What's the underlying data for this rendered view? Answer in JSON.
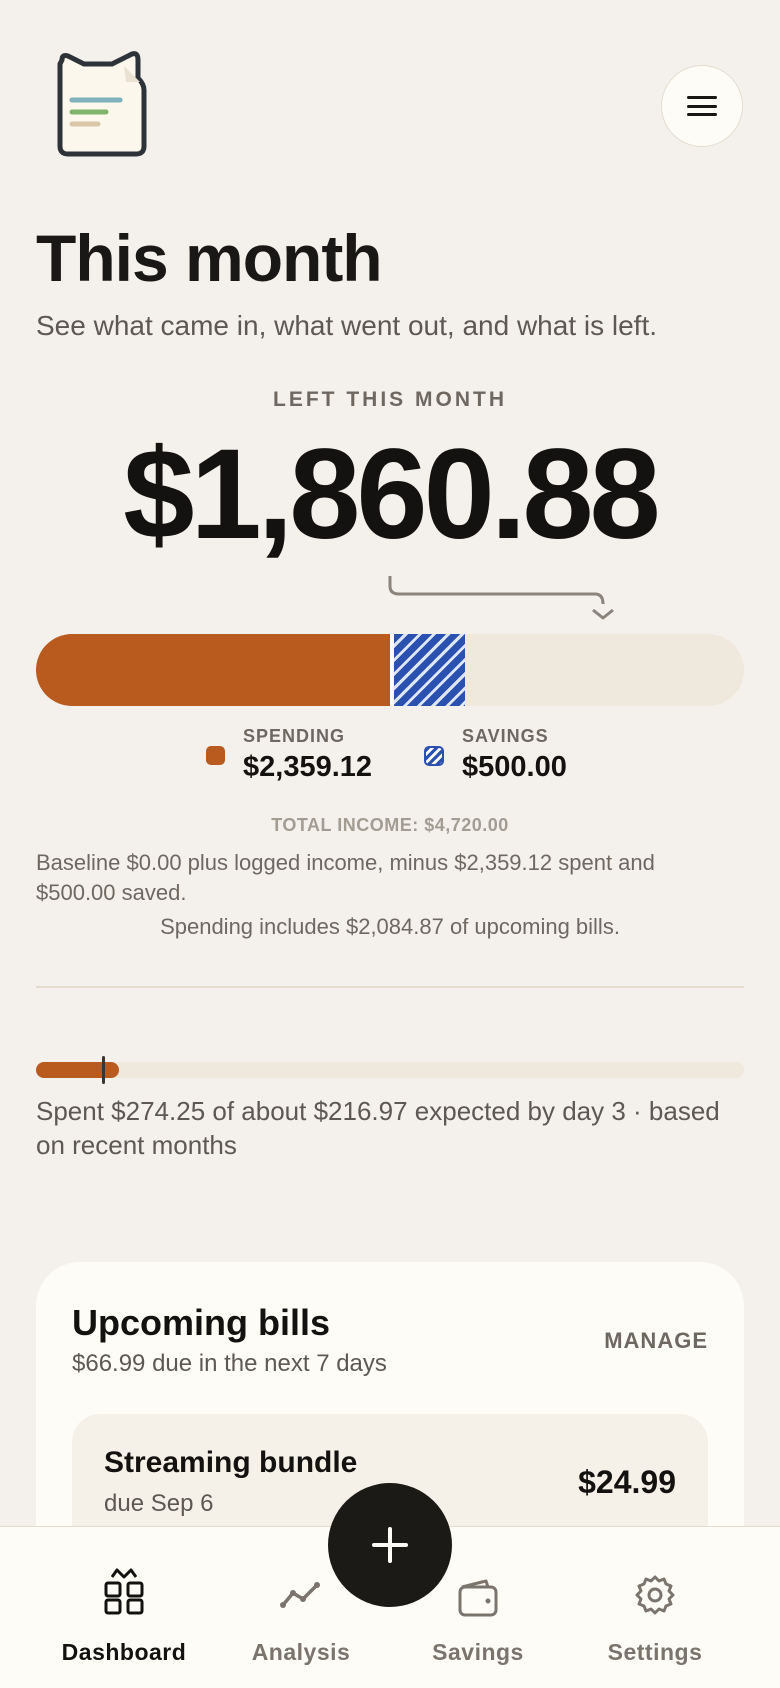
{
  "header": {
    "logo_icon": "notepad-cat-icon",
    "menu_icon": "hamburger-menu-icon"
  },
  "page": {
    "title": "This month",
    "subtitle": "See what came in, what went out, and what is left."
  },
  "summary": {
    "left_label": "LEFT THIS MONTH",
    "left_amount": "$1,860.88",
    "total_income_value": 4720.0,
    "spending_value": 2359.12,
    "savings_value": 500.0,
    "spending_label": "SPENDING",
    "spending_amount": "$2,359.12",
    "savings_label": "SAVINGS",
    "savings_amount": "$500.00",
    "total_income": "TOTAL INCOME: $4,720.00",
    "baseline_note": "Baseline $0.00 plus logged income, minus $2,359.12 spent and $500.00 saved.",
    "upcoming_note": "Spending includes $2,084.87 of upcoming bills.",
    "colors": {
      "spending": "#b95a1f",
      "savings": "#2a50b0",
      "remaining": "#efe8dd"
    }
  },
  "pace": {
    "spent_value": 274.25,
    "expected_value": 216.97,
    "note": "Spent $274.25 of about $216.97 expected by day 3 · based on recent months"
  },
  "bills": {
    "title": "Upcoming bills",
    "subtitle": "$66.99 due in the next 7 days",
    "manage_label": "MANAGE",
    "items": [
      {
        "name": "Streaming bundle",
        "due": "due Sep 6",
        "amount": "$24.99"
      }
    ]
  },
  "fab": {
    "icon": "plus-icon"
  },
  "nav": {
    "items": [
      {
        "label": "Dashboard",
        "icon": "dashboard-grid-icon",
        "active": true
      },
      {
        "label": "Analysis",
        "icon": "trend-line-icon",
        "active": false
      },
      {
        "label": "Savings",
        "icon": "wallet-icon",
        "active": false
      },
      {
        "label": "Settings",
        "icon": "gear-icon",
        "active": false
      }
    ]
  }
}
